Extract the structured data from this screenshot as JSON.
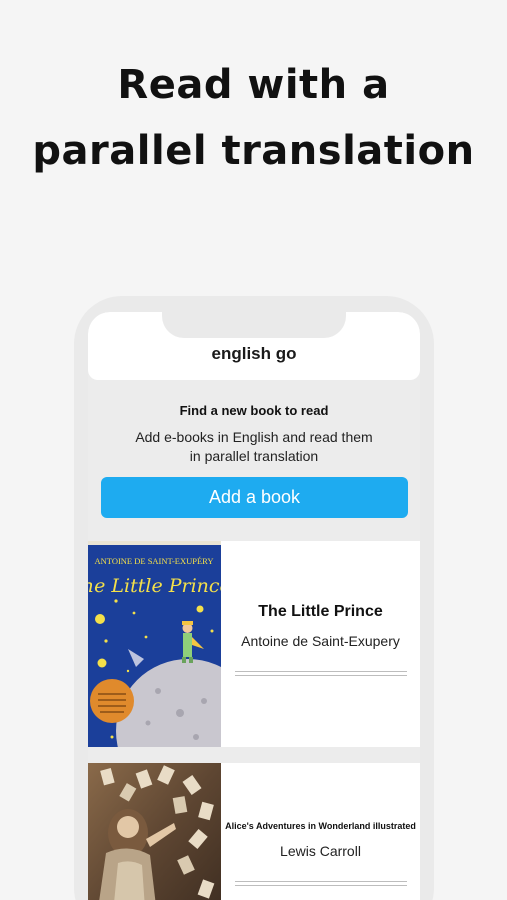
{
  "headline": {
    "line1": "Read with a",
    "line2": "parallel translation"
  },
  "app": {
    "title": "english go"
  },
  "find": {
    "title": "Find a new book to read",
    "description_line1": "Add e-books in English and read them",
    "description_line2": "in parallel translation",
    "button_label": "Add a book"
  },
  "books": [
    {
      "title": "The Little Prince",
      "author": "Antoine de Saint-Exupery",
      "cover_author": "ANTOINE DE SAINT-EXUPÉRY",
      "cover_title": "The Little Prince",
      "progress": 0
    },
    {
      "title": "Alice's Adventures in Wonderland illustrated",
      "author": "Lewis  Carroll",
      "progress": 0
    }
  ],
  "colors": {
    "accent": "#1eabf0",
    "background": "#f5f5f5",
    "cover_blue": "#1b3f9a"
  }
}
